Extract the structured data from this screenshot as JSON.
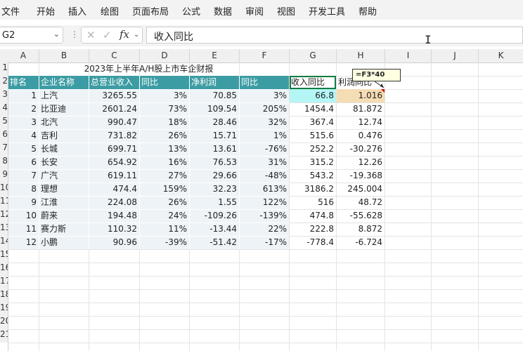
{
  "menu": [
    "文件",
    "开始",
    "插入",
    "绘图",
    "页面布局",
    "公式",
    "数据",
    "审阅",
    "视图",
    "开发工具",
    "帮助"
  ],
  "formula_bar": {
    "namebox": "G2",
    "content": "收入同比"
  },
  "columns": [
    "A",
    "B",
    "C",
    "D",
    "E",
    "F",
    "G",
    "H",
    "I",
    "J",
    "K"
  ],
  "rows": [
    "1",
    "2",
    "3",
    "4",
    "5",
    "6",
    "7",
    "8",
    "9",
    "10",
    "11",
    "12",
    "13",
    "14",
    "15",
    "16",
    "17",
    "18",
    "19",
    "20",
    "21"
  ],
  "sheet": {
    "title": "2023年上半年A/H股上市车企财报",
    "headers": [
      "排名",
      "企业名称",
      "总营业收入",
      "同比",
      "净利润",
      "同比",
      "收入同比",
      "利润同比"
    ],
    "data": [
      [
        "1",
        "上汽",
        "3265.55",
        "3%",
        "70.85",
        "3%",
        "66.8",
        "1.016"
      ],
      [
        "2",
        "比亚迪",
        "2601.24",
        "73%",
        "109.54",
        "205%",
        "1454.4",
        "81.872"
      ],
      [
        "3",
        "北汽",
        "990.47",
        "18%",
        "28.46",
        "32%",
        "367.4",
        "12.74"
      ],
      [
        "4",
        "吉利",
        "731.82",
        "26%",
        "15.71",
        "1%",
        "515.6",
        "0.476"
      ],
      [
        "5",
        "长城",
        "699.71",
        "13%",
        "13.61",
        "-76%",
        "252.2",
        "-30.276"
      ],
      [
        "6",
        "长安",
        "654.92",
        "16%",
        "76.53",
        "31%",
        "315.2",
        "12.26"
      ],
      [
        "7",
        "广汽",
        "619.11",
        "27%",
        "29.66",
        "-48%",
        "543.2",
        "-19.368"
      ],
      [
        "8",
        "理想",
        "474.4",
        "159%",
        "32.23",
        "613%",
        "3186.2",
        "245.004"
      ],
      [
        "9",
        "江淮",
        "224.08",
        "26%",
        "1.55",
        "122%",
        "516",
        "48.72"
      ],
      [
        "10",
        "蔚来",
        "194.48",
        "24%",
        "-109.26",
        "-139%",
        "474.8",
        "-55.628"
      ],
      [
        "11",
        "赛力斯",
        "110.32",
        "11%",
        "-13.44",
        "22%",
        "222.8",
        "8.872"
      ],
      [
        "12",
        "小鹏",
        "90.96",
        "-39%",
        "-51.42",
        "-17%",
        "-778.4",
        "-6.724"
      ]
    ]
  },
  "comment": "=F3*40",
  "colors": {
    "header_fill": "#3c9ca3",
    "body_fill": "#eef3f7",
    "g3_fill": "#b4f5f5",
    "h3_fill": "#f4dcb4"
  }
}
